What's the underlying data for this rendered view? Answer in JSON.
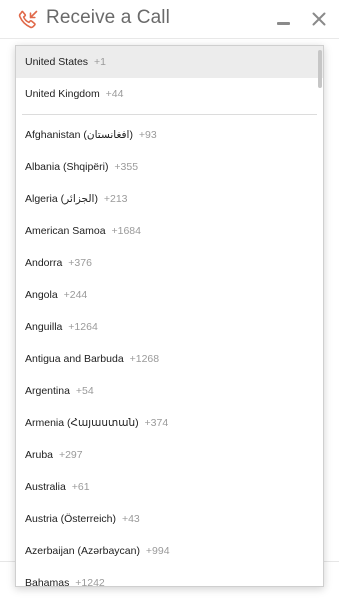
{
  "header": {
    "title": "Receive a Call",
    "icons": {
      "phone": "incoming-call-icon",
      "minimize": "minimize-icon",
      "close": "close-icon"
    },
    "accent_color": "#e0694a"
  },
  "country_dropdown": {
    "preferred": [
      {
        "name": "United States",
        "code": "+1",
        "highlighted": true
      },
      {
        "name": "United Kingdom",
        "code": "+44",
        "highlighted": false
      }
    ],
    "countries": [
      {
        "name": "Afghanistan (افغانستان)",
        "code": "+93"
      },
      {
        "name": "Albania (Shqipëri)",
        "code": "+355"
      },
      {
        "name": "Algeria (الجزائر)",
        "code": "+213"
      },
      {
        "name": "American Samoa",
        "code": "+1684"
      },
      {
        "name": "Andorra",
        "code": "+376"
      },
      {
        "name": "Angola",
        "code": "+244"
      },
      {
        "name": "Anguilla",
        "code": "+1264"
      },
      {
        "name": "Antigua and Barbuda",
        "code": "+1268"
      },
      {
        "name": "Argentina",
        "code": "+54"
      },
      {
        "name": "Armenia (Հայաստան)",
        "code": "+374"
      },
      {
        "name": "Aruba",
        "code": "+297"
      },
      {
        "name": "Australia",
        "code": "+61"
      },
      {
        "name": "Austria (Österreich)",
        "code": "+43"
      },
      {
        "name": "Azerbaijan (Azərbaycan)",
        "code": "+994"
      },
      {
        "name": "Bahamas",
        "code": "+1242"
      }
    ]
  }
}
